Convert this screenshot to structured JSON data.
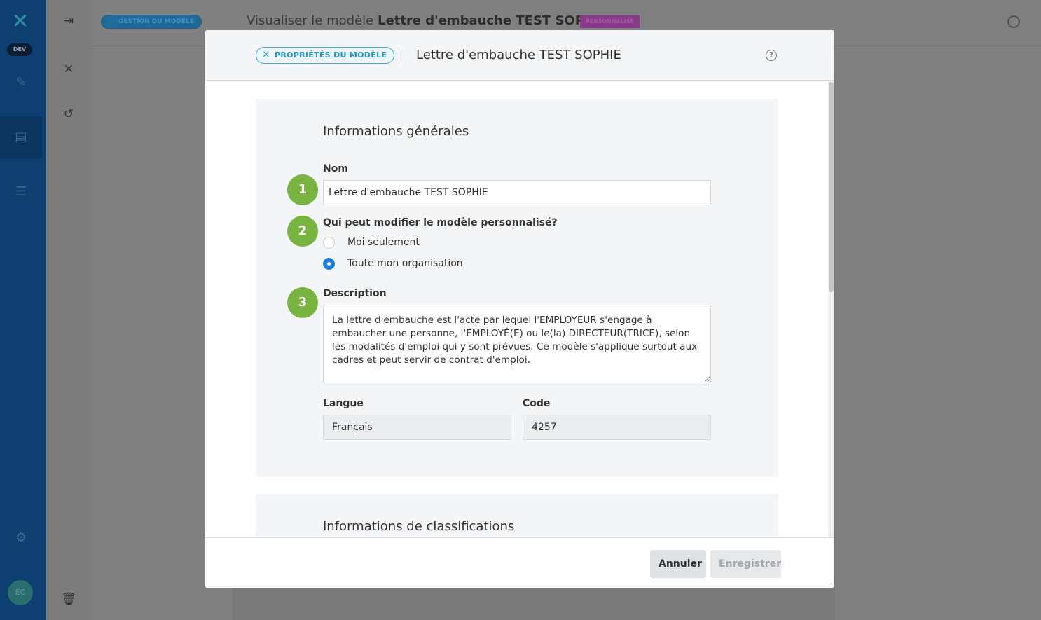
{
  "app": {
    "env_badge": "DEV",
    "avatar_initials": "EC",
    "header": {
      "badge": "GESTION DU MODÈLE",
      "title_prefix": "Visualiser le modèle",
      "title_name": "Lettre d'embauche TEST SOPHIE",
      "tag": "PERSONNALISÉ"
    }
  },
  "modal": {
    "badge": "PROPRIÉTÉS DU MODÈLE",
    "title": "Lettre d'embauche TEST SOPHIE",
    "sections": {
      "general_title": "Informations générales",
      "classification_title": "Informations de classifications"
    },
    "steps": [
      "1",
      "2",
      "3"
    ],
    "name_field": {
      "label": "Nom",
      "value": "Lettre d'embauche TEST SOPHIE"
    },
    "permissions": {
      "label": "Qui peut modifier le modèle personnalisé?",
      "options": [
        {
          "label": "Moi seulement",
          "checked": false
        },
        {
          "label": "Toute mon organisation",
          "checked": true
        }
      ]
    },
    "description": {
      "label": "Description",
      "value": "La lettre d'embauche est l'acte par lequel l'EMPLOYEUR s'engage à embaucher une personne, l'EMPLOYÉ(E) ou le(la) DIRECTEUR(TRICE), selon les modalités d'emploi qui y sont prévues. Ce modèle s'applique surtout aux cadres et peut servir de contrat d'emploi."
    },
    "language": {
      "label": "Langue",
      "value": "Français"
    },
    "code": {
      "label": "Code",
      "value": "4257"
    },
    "footer": {
      "cancel": "Annuler",
      "save": "Enregistrer"
    }
  },
  "colors": {
    "primary_blue": "#1a7fe0",
    "step_green": "#78b440",
    "badge_blue": "#2b95c9",
    "sidebar": "#0d3f70"
  }
}
